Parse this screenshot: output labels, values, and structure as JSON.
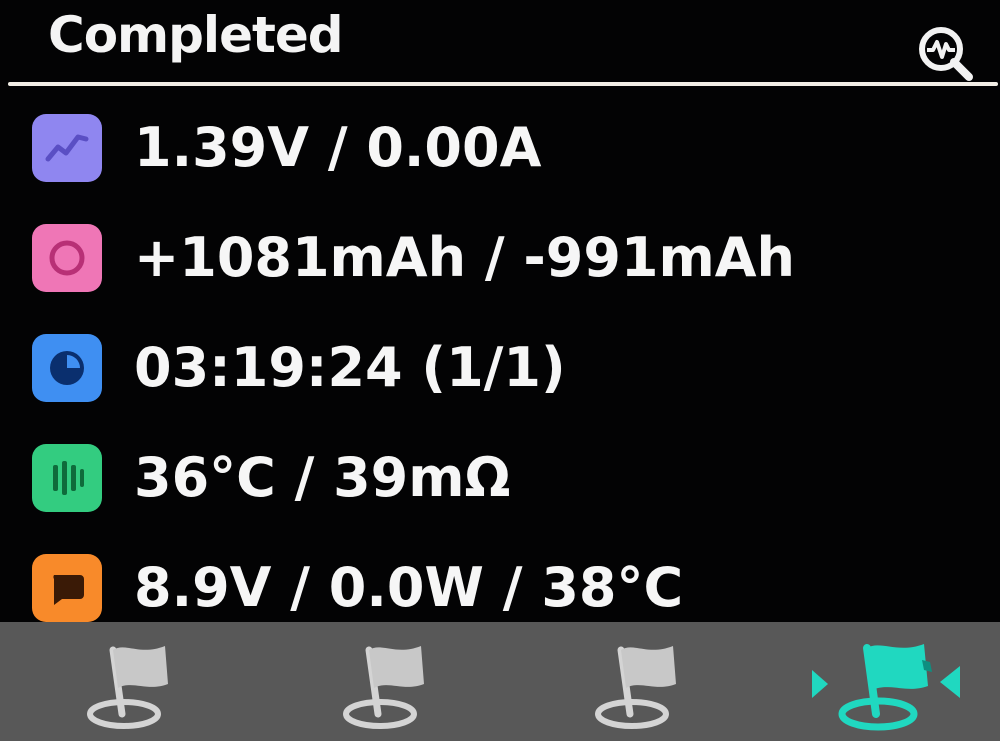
{
  "header": {
    "title": "Completed",
    "search_icon": "search-waveform-icon"
  },
  "rows": [
    {
      "icon": "line-chart-icon",
      "color": "#8f86f0",
      "value": "1.39V / 0.00A"
    },
    {
      "icon": "circle-icon",
      "color": "#ef76b6",
      "value": "+1081mAh / -991mAh"
    },
    {
      "icon": "clock-icon",
      "color": "#3f8ff2",
      "value": "03:19:24 (1/1)"
    },
    {
      "icon": "bars-icon",
      "color": "#33cc80",
      "value": "36°C / 39mΩ"
    },
    {
      "icon": "chat-bubble-icon",
      "color": "#f88a2a",
      "value": "8.9V / 0.0W / 38°C"
    }
  ],
  "footer": {
    "slots": [
      {
        "icon": "flag-icon",
        "active": false,
        "color": "#c8c8c8"
      },
      {
        "icon": "flag-icon",
        "active": false,
        "color": "#c8c8c8"
      },
      {
        "icon": "flag-icon",
        "active": false,
        "color": "#c8c8c8"
      },
      {
        "icon": "flag-icon",
        "active": true,
        "color": "#20d8c0"
      }
    ]
  }
}
